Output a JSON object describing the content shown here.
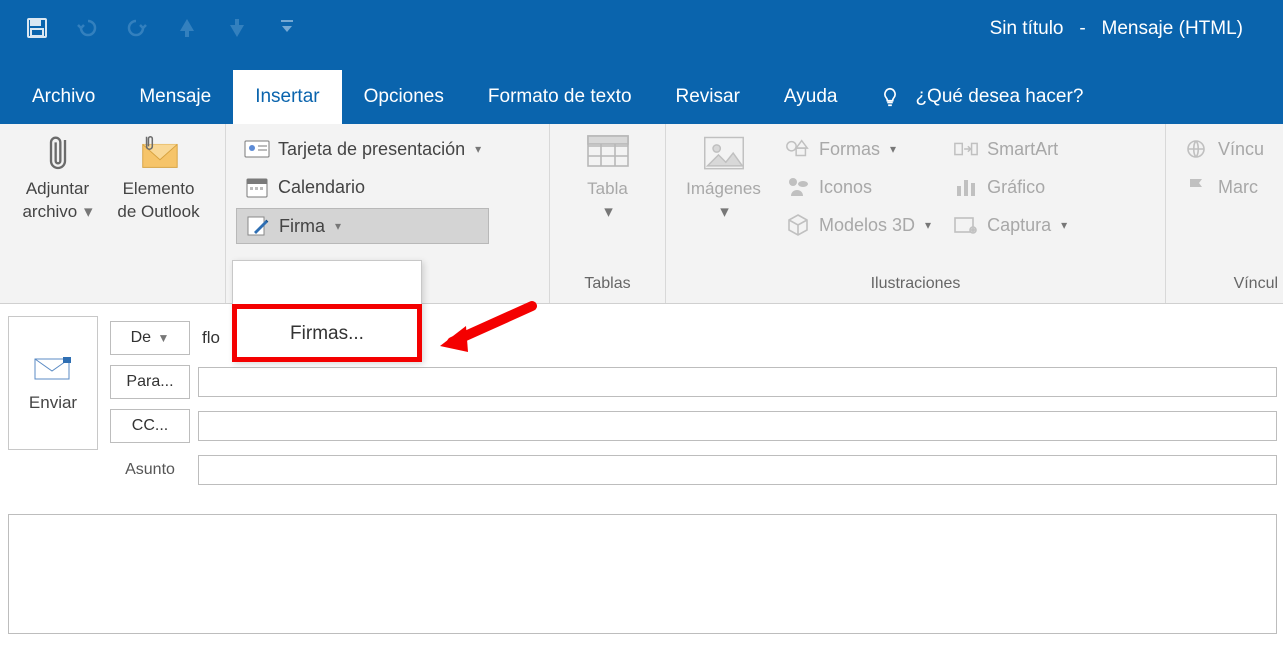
{
  "title": {
    "doc": "Sin título",
    "sep": "-",
    "mode": "Mensaje (HTML)"
  },
  "tabs": {
    "archivo": "Archivo",
    "mensaje": "Mensaje",
    "insertar": "Insertar",
    "opciones": "Opciones",
    "formato": "Formato de texto",
    "revisar": "Revisar",
    "ayuda": "Ayuda",
    "tellme": "¿Qué desea hacer?"
  },
  "ribbon": {
    "adjuntar1": "Adjuntar",
    "adjuntar2": "archivo",
    "outlook1": "Elemento",
    "outlook2": "de Outlook",
    "tarjeta": "Tarjeta de presentación",
    "calendario": "Calendario",
    "firma": "Firma",
    "tabla": "Tabla",
    "tablas_group": "Tablas",
    "imagenes": "Imágenes",
    "formas": "Formas",
    "iconos": "Iconos",
    "modelos3d": "Modelos 3D",
    "smartart": "SmartArt",
    "grafico": "Gráfico",
    "captura": "Captura",
    "ilustraciones_group": "Ilustraciones",
    "vinculo_cut": "Víncu",
    "marcador_cut": "Marc",
    "vinculos_group": "Víncul"
  },
  "dropdown": {
    "firmas": "Firmas..."
  },
  "compose": {
    "enviar": "Enviar",
    "de": "De",
    "de_value": "flo",
    "para": "Para...",
    "cc": "CC...",
    "asunto": "Asunto"
  }
}
